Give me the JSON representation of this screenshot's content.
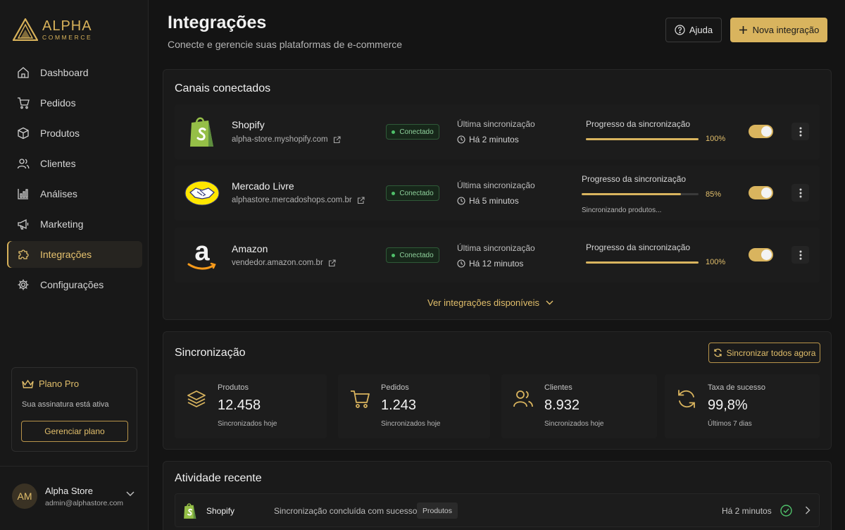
{
  "brand": {
    "name": "ALPHA",
    "tagline": "COMMERCE"
  },
  "sidebar": {
    "items": [
      {
        "label": "Dashboard",
        "icon": "home-icon"
      },
      {
        "label": "Pedidos",
        "icon": "cart-icon"
      },
      {
        "label": "Produtos",
        "icon": "box-icon"
      },
      {
        "label": "Clientes",
        "icon": "users-icon"
      },
      {
        "label": "Análises",
        "icon": "bar-chart-icon"
      },
      {
        "label": "Marketing",
        "icon": "megaphone-icon"
      },
      {
        "label": "Integrações",
        "icon": "puzzle-icon",
        "active": true
      },
      {
        "label": "Configurações",
        "icon": "gear-icon"
      }
    ],
    "plan": {
      "title": "Plano Pro",
      "subtitle": "Sua assinatura está ativa",
      "button": "Gerenciar plano"
    },
    "user": {
      "initials": "AM",
      "name": "Alpha Store",
      "email": "admin@alphastore.com"
    }
  },
  "header": {
    "title": "Integrações",
    "subtitle": "Conecte e gerencie suas plataformas de e-commerce",
    "help_label": "Ajuda",
    "new_label": "Nova integração"
  },
  "channels": {
    "title": "Canais conectados",
    "items": [
      {
        "name": "Shopify",
        "url": "alpha-store.myshopify.com",
        "status": "Conectado",
        "sync_label": "Última sincronização",
        "sync_time": "Há 2 minutos",
        "progress_label": "Progresso da sincronização",
        "progress": 100,
        "progress_text": "100%",
        "enabled": true
      },
      {
        "name": "Mercado Livre",
        "url": "alphastore.mercadoshops.com.br",
        "status": "Conectado",
        "sync_label": "Última sincronização",
        "sync_time": "Há 5 minutos",
        "progress_label": "Progresso da sincronização",
        "progress": 85,
        "progress_text": "85%",
        "progress_note": "Sincronizando produtos...",
        "enabled": true
      },
      {
        "name": "Amazon",
        "url": "vendedor.amazon.com.br",
        "status": "Conectado",
        "sync_label": "Última sincronização",
        "sync_time": "Há 12 minutos",
        "progress_label": "Progresso da sincronização",
        "progress": 100,
        "progress_text": "100%",
        "enabled": true
      }
    ],
    "see_more": "Ver integrações disponíveis"
  },
  "sync": {
    "title": "Sincronização",
    "button": "Sincronizar todos agora",
    "stats": [
      {
        "label": "Produtos",
        "value": "12.458",
        "note": "Sincronizados hoje",
        "icon": "layers-icon"
      },
      {
        "label": "Pedidos",
        "value": "1.243",
        "note": "Sincronizados hoje",
        "icon": "cart-icon"
      },
      {
        "label": "Clientes",
        "value": "8.932",
        "note": "Sincronizados hoje",
        "icon": "users-icon"
      },
      {
        "label": "Taxa de sucesso",
        "value": "99,8%",
        "note": "Últimos 7 dias",
        "icon": "refresh-icon"
      }
    ]
  },
  "activity": {
    "title": "Atividade recente",
    "items": [
      {
        "platform": "Shopify",
        "message": "Sincronização concluída com sucesso",
        "tag": "Produtos",
        "time": "Há 2 minutos"
      }
    ]
  },
  "colors": {
    "accent": "#d9b45e",
    "success": "#4fc06a",
    "background": "#141414"
  }
}
